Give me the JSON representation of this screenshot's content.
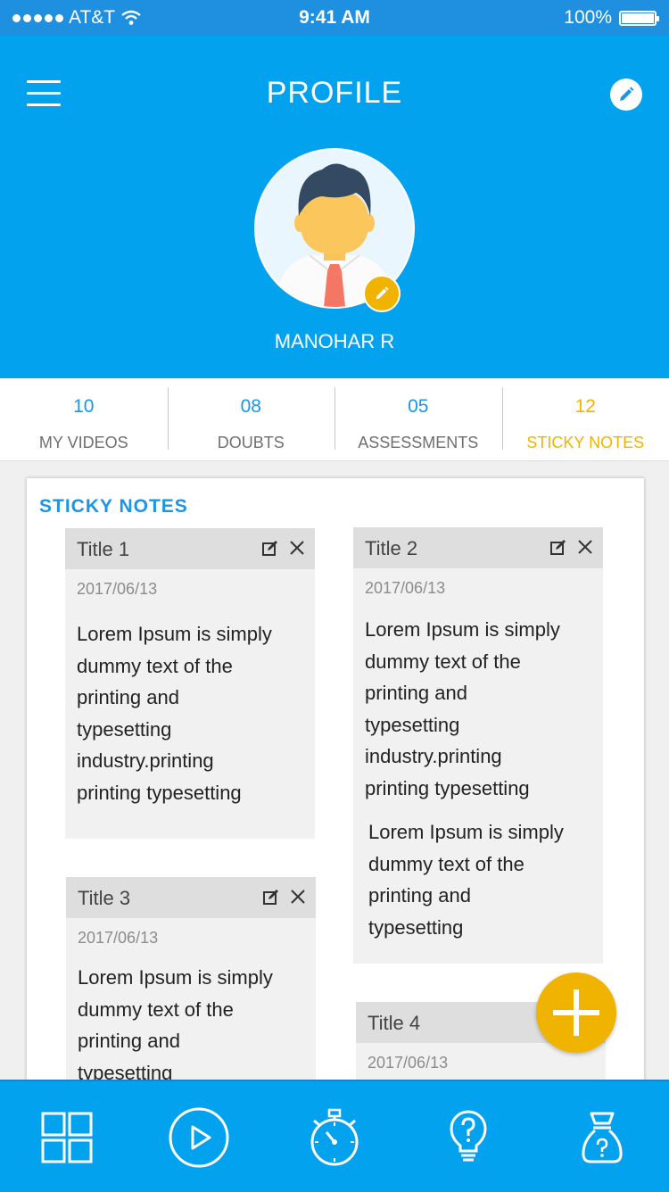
{
  "status_bar": {
    "carrier": "AT&T",
    "time": "9:41 AM",
    "battery": "100%",
    "battery_level": 1.0
  },
  "header": {
    "title": "PROFILE",
    "user_name": "MANOHAR R"
  },
  "tabs": [
    {
      "count": "10",
      "label": "MY VIDEOS"
    },
    {
      "count": "08",
      "label": "DOUBTS"
    },
    {
      "count": "05",
      "label": "ASSESSMENTS"
    },
    {
      "count": "12",
      "label": "STICKY NOTES",
      "active": true
    }
  ],
  "sticky_notes": {
    "heading": "STICKY NOTES",
    "notes": [
      {
        "title": "Title 1",
        "date": "2017/06/13",
        "body": [
          "Lorem Ipsum is simply",
          "dummy text of the",
          "printing and",
          "typesetting",
          "industry.printing",
          "printing typesetting"
        ]
      },
      {
        "title": "Title 2",
        "date": "2017/06/13",
        "body": [
          "Lorem Ipsum is simply",
          "dummy text of the",
          "printing and",
          "typesetting",
          "industry.printing",
          "printing typesetting"
        ],
        "body2": [
          "Lorem Ipsum is simply",
          "dummy text of the",
          "printing and",
          "typesetting"
        ]
      },
      {
        "title": "Title 3",
        "date": "2017/06/13",
        "body": [
          "Lorem Ipsum is simply",
          "dummy text of the",
          "printing and",
          "typesetting"
        ]
      },
      {
        "title": "Title 4",
        "date": "2017/06/13"
      }
    ]
  },
  "bottom_nav": [
    "grid-icon",
    "play-icon",
    "stopwatch-icon",
    "lightbulb-icon",
    "money-bag-icon"
  ],
  "colors": {
    "primary": "#03a2ee",
    "accent": "#f0b400",
    "link": "#1a96e6"
  }
}
